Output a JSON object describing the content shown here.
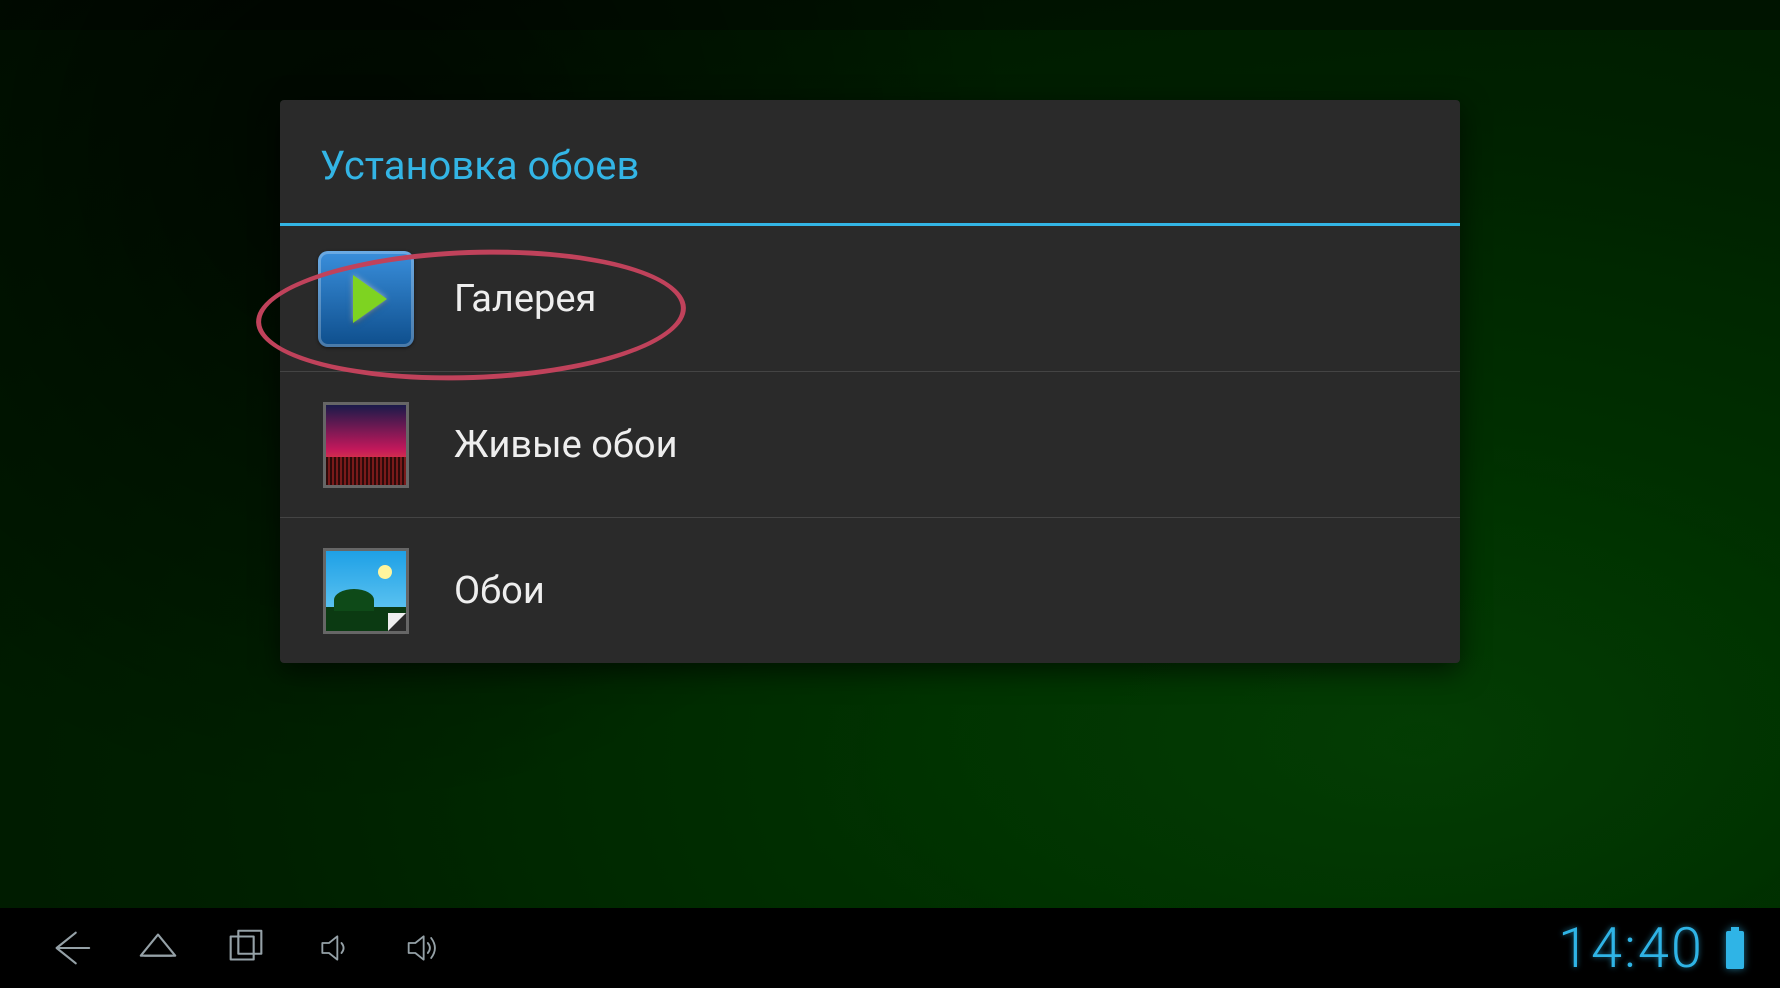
{
  "dialog": {
    "title": "Установка обоев",
    "items": [
      {
        "label": "Галерея",
        "icon": "gallery-icon"
      },
      {
        "label": "Живые обои",
        "icon": "live-wallpaper-icon"
      },
      {
        "label": "Обои",
        "icon": "wallpapers-icon"
      }
    ]
  },
  "navbar": {
    "clock": "14:40"
  },
  "annotation": {
    "highlighted_item_index": 0
  }
}
